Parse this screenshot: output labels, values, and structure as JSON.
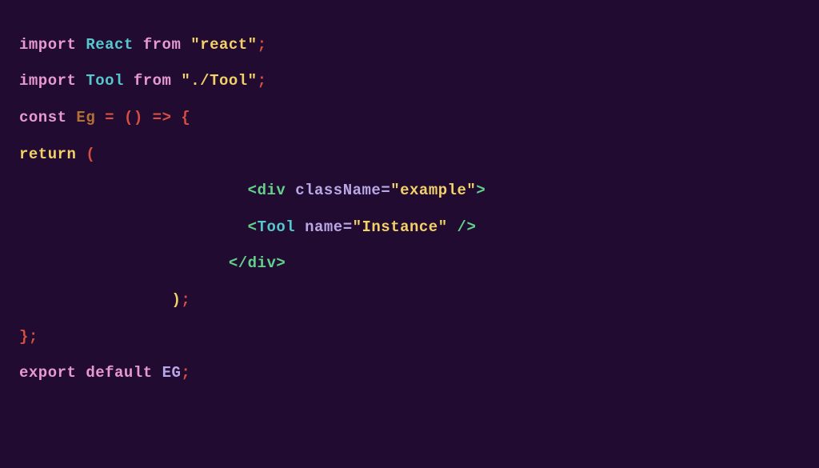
{
  "code": {
    "line1": {
      "import": "import",
      "ident": "React",
      "from": "from",
      "str": "\"react\"",
      "semi": ";"
    },
    "line3": {
      "import": "import",
      "ident": "Tool",
      "from": "from",
      "str": "\"./Tool\"",
      "semi": ";"
    },
    "line5": {
      "const": "const",
      "name": "Eg",
      "eq": "=",
      "parens": "()",
      "arrow": "=>",
      "brace": "{"
    },
    "line7": {
      "return": "return",
      "paren": "("
    },
    "line9": {
      "open": "<",
      "tag": "div",
      "attr": "className",
      "eq": "=",
      "str": "\"example\"",
      "close": ">"
    },
    "line11": {
      "open": "<",
      "comp": "Tool",
      "attr": "name",
      "eq": "=",
      "str": "\"Instance\"",
      "slash": "/",
      "close": ">"
    },
    "line13": {
      "open": "<",
      "slash": "/",
      "tag": "div",
      "close": ">"
    },
    "line15": {
      "paren": ")",
      "semi": ";"
    },
    "line17": {
      "brace": "}",
      "semi": ";"
    },
    "line19": {
      "export": "export",
      "default": "default",
      "ident": "EG",
      "semi": ";"
    }
  }
}
